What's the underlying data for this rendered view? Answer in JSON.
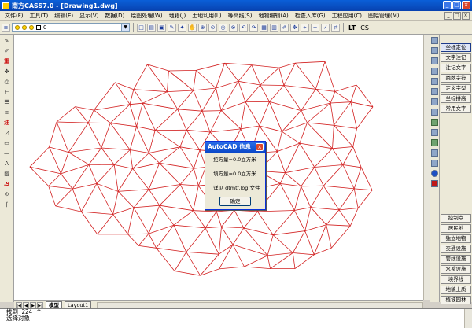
{
  "window": {
    "title": "南方CASS7.0 - [Drawing1.dwg]",
    "minimize_label": "_",
    "maximize_label": "□",
    "close_label": "×"
  },
  "menu": [
    "文件(F)",
    "工具(T)",
    "编辑(E)",
    "显示(V)",
    "数据(D)",
    "绘图处理(W)",
    "地籍(J)",
    "土地利用(L)",
    "等高线(S)",
    "地物编辑(A)",
    "检查入库(G)",
    "工程应用(C)",
    "图幅管理(M)"
  ],
  "toolbar": {
    "layer_name": "0",
    "lt_label": "LT",
    "cs_label": "CS"
  },
  "right_panel": {
    "top_buttons": [
      "坐标定位",
      "文字注记",
      "注记文字",
      "类数字符",
      "定义字型",
      "坐标拼高",
      "常用文字"
    ],
    "bottom_buttons": [
      "控制点",
      "居民地",
      "独立地物",
      "交通设施",
      "管线设施",
      "水系设施",
      "境界线",
      "地貌土质",
      "植被园林"
    ]
  },
  "left_toolbar_icons": [
    "pencil-icon",
    "edit-icon",
    "delete-icon",
    "move-icon",
    "print-icon",
    "dimension-icon",
    "layer-icon",
    "lines-icon",
    "note-icon",
    "polyline-icon",
    "rectangle-icon",
    "line-icon",
    "text-icon",
    "hatch-icon",
    "point-icon",
    "tangent-icon",
    "spline-icon"
  ],
  "dialog": {
    "title": "AutoCAD 信息",
    "line1": "挖方量=0.0立方米",
    "line2": "填方量=0.0立方米",
    "line3": "详见 dtmtf.log 文件",
    "ok_label": "确定"
  },
  "tabs": [
    "模型",
    "Layout1"
  ],
  "command_lines": [
    "找到 224 个",
    "选择对象"
  ],
  "colors": {
    "tin_lines": "#d22020",
    "title_bar": "#0a5fd8"
  }
}
